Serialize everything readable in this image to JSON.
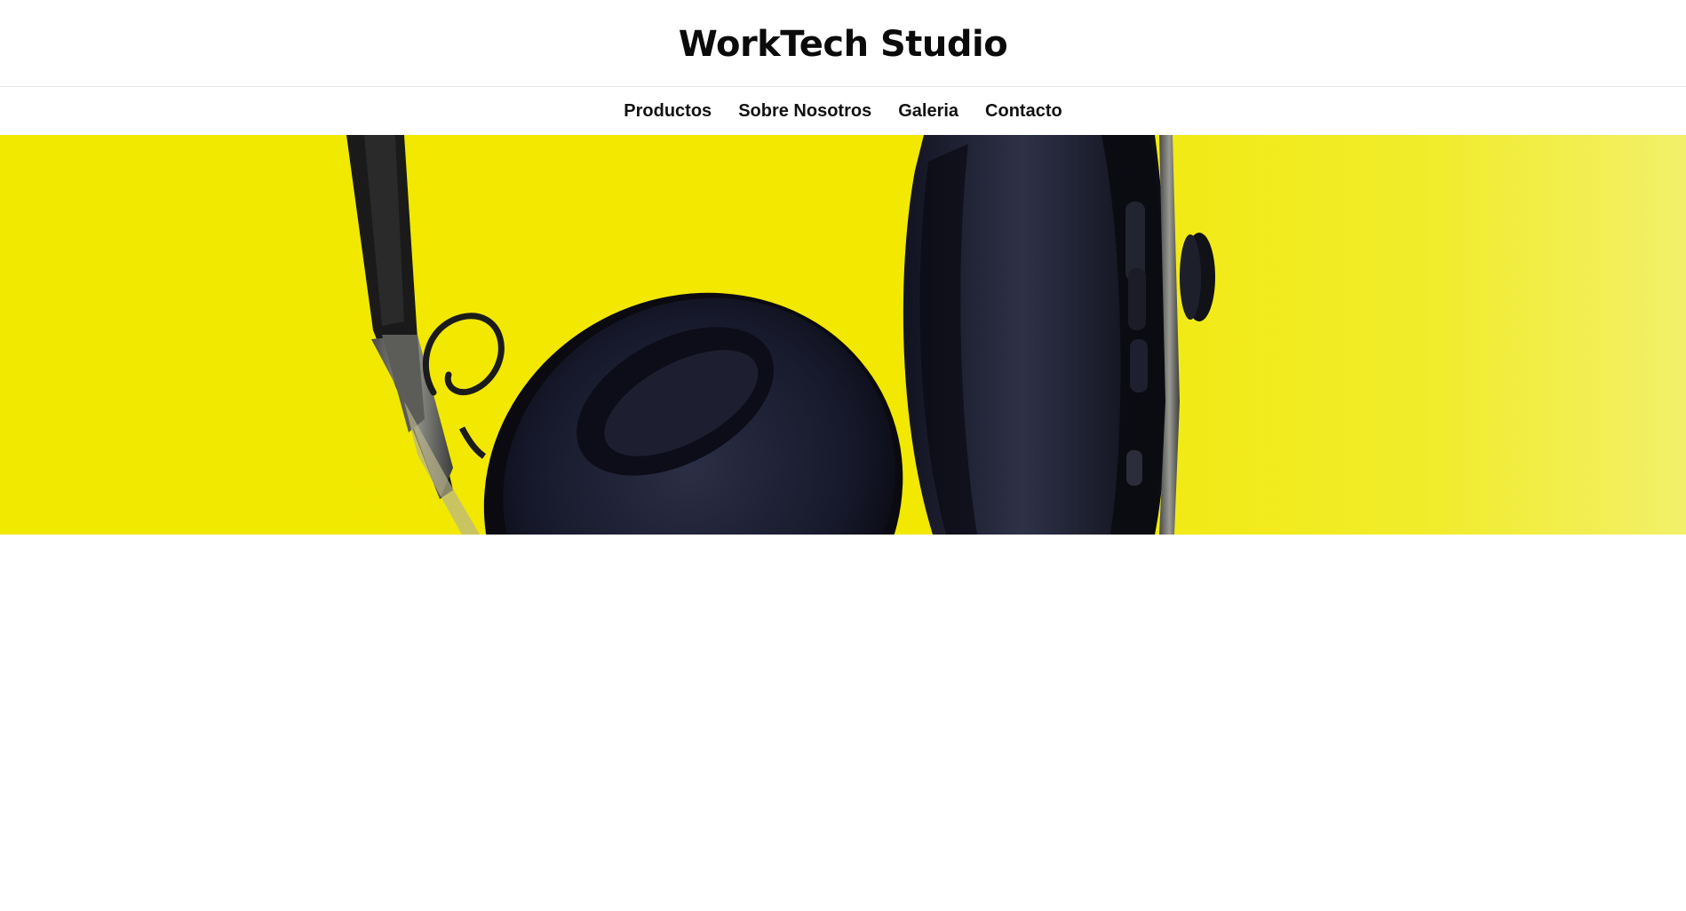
{
  "site": {
    "title": "WorkTech Studio"
  },
  "nav": {
    "items": [
      {
        "label": "Productos"
      },
      {
        "label": "Sobre Nosotros"
      },
      {
        "label": "Galeria"
      },
      {
        "label": "Contacto"
      }
    ]
  },
  "hero": {
    "image": "headphones-on-yellow-background",
    "background_color": "#f1e900"
  },
  "colors": {
    "text": "#0b0b0b",
    "divider": "#e6e6e6"
  }
}
